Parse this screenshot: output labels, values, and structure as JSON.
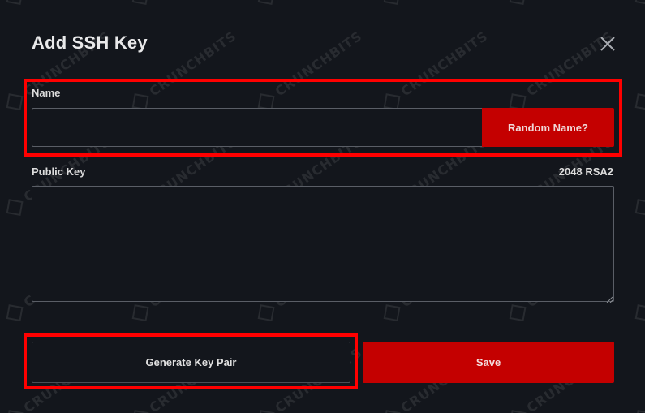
{
  "modal": {
    "title": "Add SSH Key",
    "close_icon": "close-icon"
  },
  "name_field": {
    "label": "Name",
    "value": "",
    "placeholder": ""
  },
  "random_name_button": {
    "label": "Random Name?"
  },
  "public_key_field": {
    "label": "Public Key",
    "key_type": "2048 RSA2",
    "value": ""
  },
  "generate_button": {
    "label": "Generate Key Pair"
  },
  "save_button": {
    "label": "Save"
  },
  "watermark": {
    "text": "CRUNCHBITS"
  },
  "colors": {
    "background": "#13161c",
    "accent": "#c40000",
    "highlight": "#ff0000",
    "border": "#5a5e66"
  }
}
